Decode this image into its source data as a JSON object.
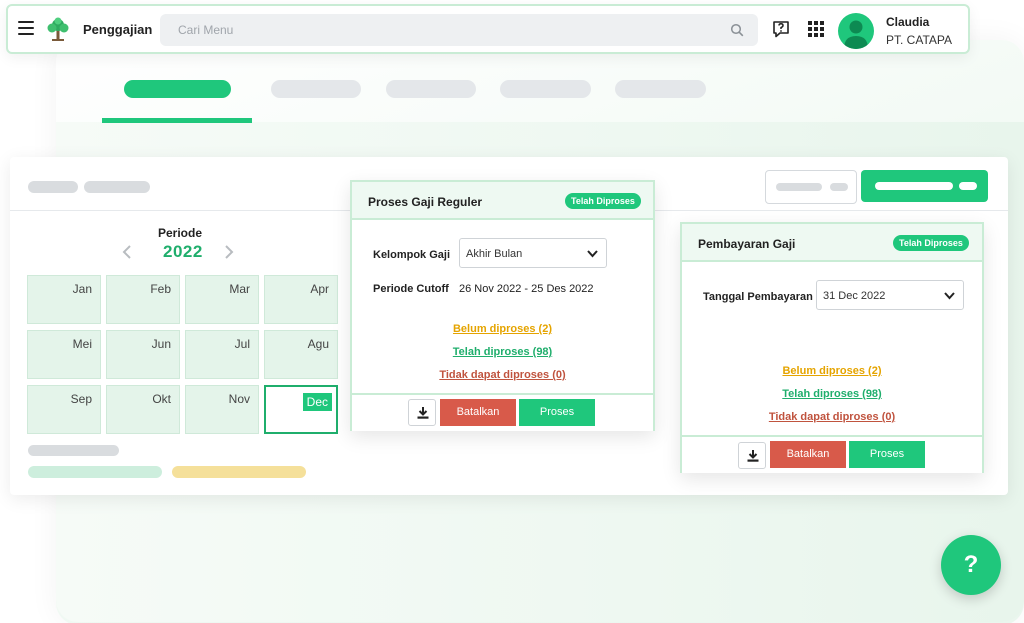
{
  "header": {
    "app_title": "Penggajian",
    "search_placeholder": "Cari Menu",
    "user_name": "Claudia",
    "user_company": "PT. CATAPA"
  },
  "periode": {
    "label": "Periode",
    "year": "2022",
    "months": [
      "Jan",
      "Feb",
      "Mar",
      "Apr",
      "Mei",
      "Jun",
      "Jul",
      "Agu",
      "Sep",
      "Okt",
      "Nov",
      "Dec"
    ],
    "selected_month": "Dec"
  },
  "proses_gaji": {
    "title": "Proses Gaji Reguler",
    "badge": "Telah Diproses",
    "kelompok_label": "Kelompok Gaji",
    "kelompok_value": "Akhir Bulan",
    "cutoff_label": "Periode Cutoff",
    "cutoff_value": "26 Nov 2022 - 25 Des 2022",
    "status_belum": "Belum diproses (2)",
    "status_telah": "Telah diproses (98)",
    "status_tidak": "Tidak dapat diproses (0)",
    "cancel_label": "Batalkan",
    "process_label": "Proses"
  },
  "pembayaran_gaji": {
    "title": "Pembayaran Gaji",
    "badge": "Telah Diproses",
    "tanggal_label": "Tanggal Pembayaran",
    "tanggal_value": "31 Dec 2022",
    "status_belum": "Belum diproses (2)",
    "status_telah": "Telah diproses (98)",
    "status_tidak": "Tidak dapat diproses (0)",
    "cancel_label": "Batalkan",
    "process_label": "Proses"
  },
  "help": {
    "fab_label": "?"
  },
  "colors": {
    "accent": "#1fc77c",
    "danger": "#d85a4a",
    "warning": "#e5a400",
    "error_text": "#c0533e"
  }
}
